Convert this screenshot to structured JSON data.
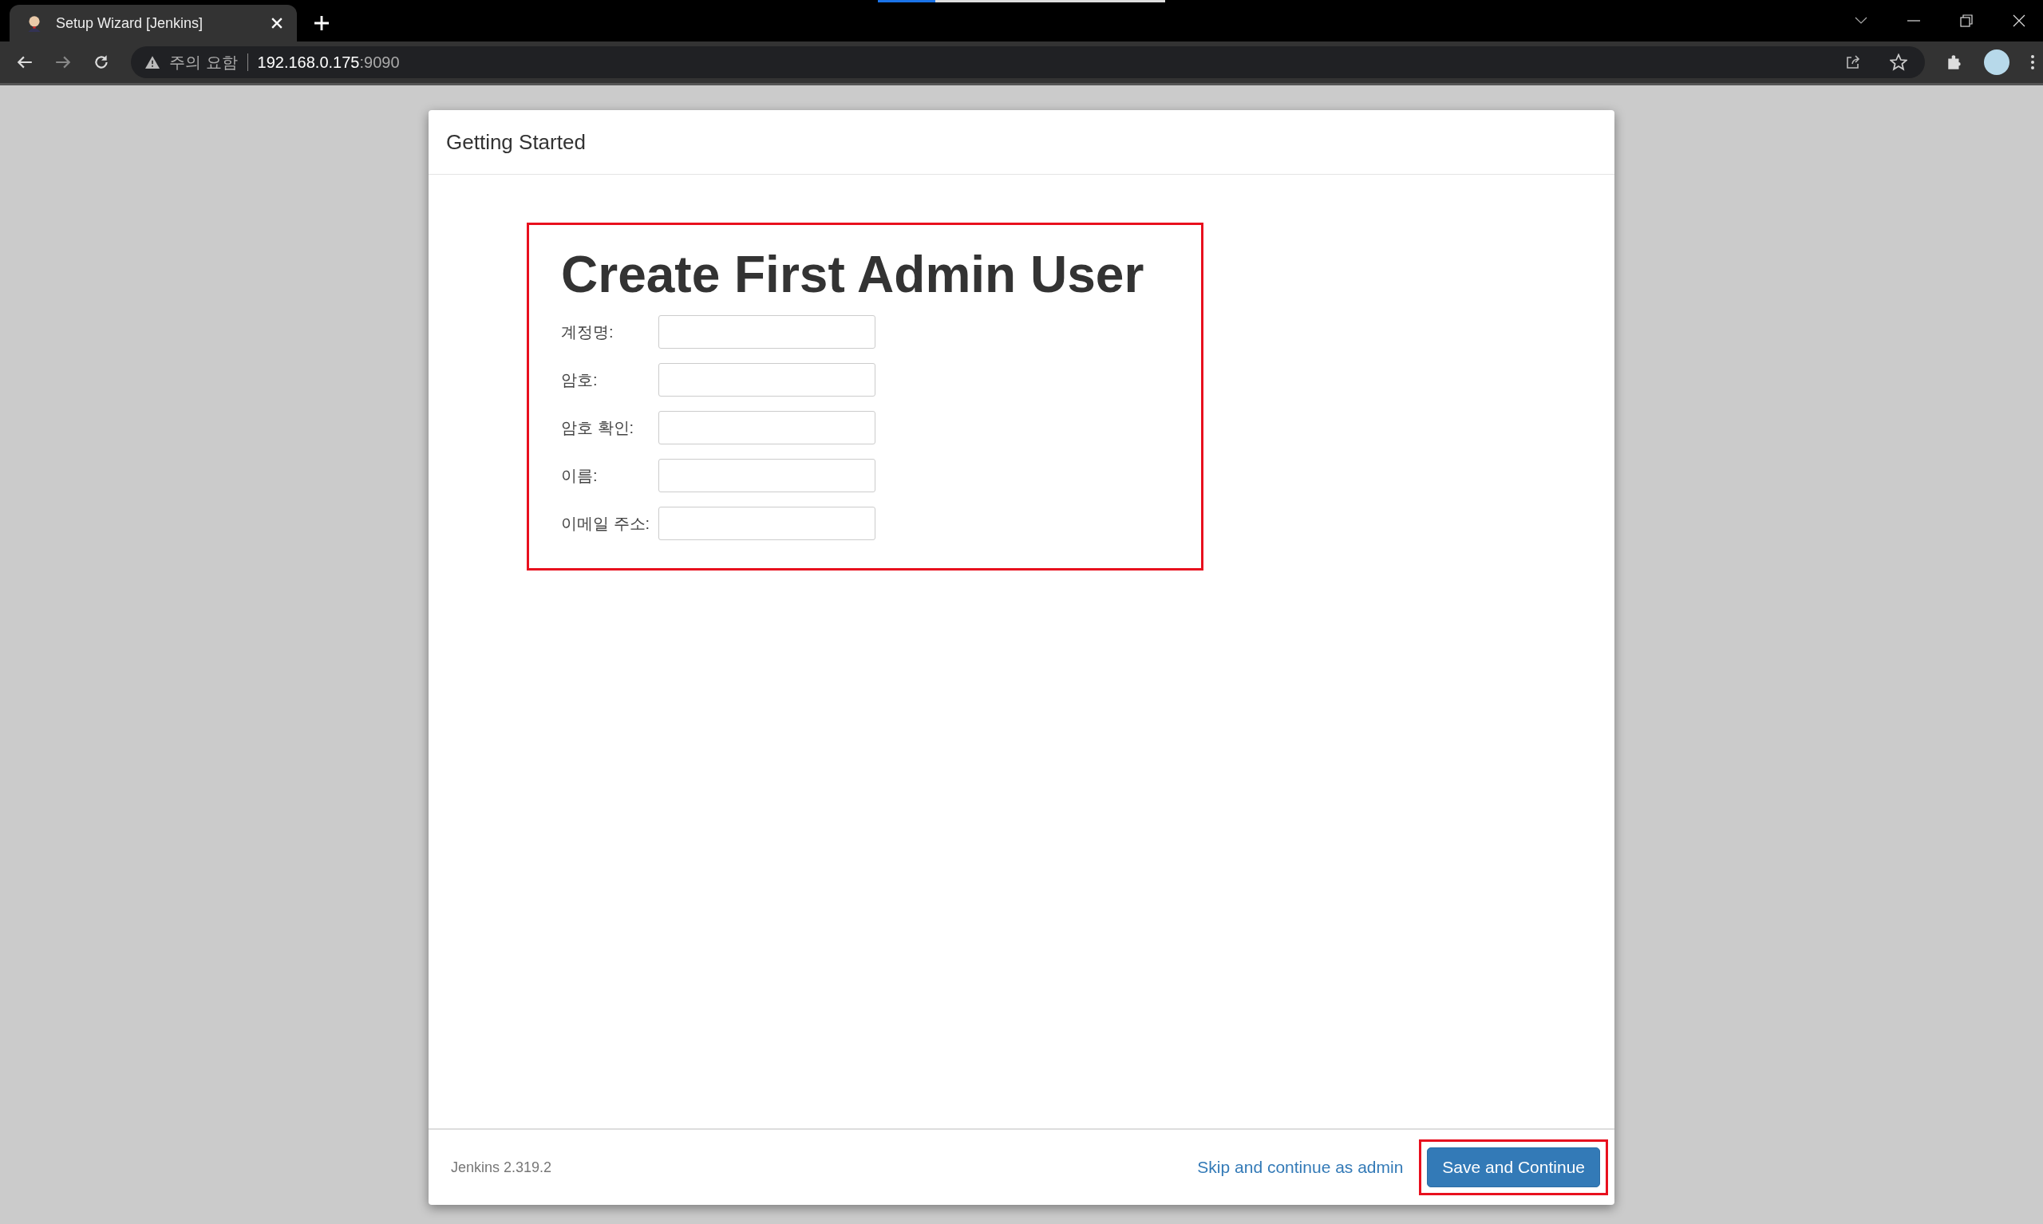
{
  "browser": {
    "tab": {
      "title": "Setup Wizard [Jenkins]",
      "selected": true
    },
    "address": {
      "warning": "주의 요함",
      "host": "192.168.0.175",
      "port": ":9090"
    }
  },
  "dialog": {
    "title": "Getting Started",
    "form": {
      "highlighted": true,
      "heading": "Create First Admin User",
      "fields": [
        {
          "label": "계정명:"
        },
        {
          "label": "암호:"
        },
        {
          "label": "암호 확인:"
        },
        {
          "label": "이름:"
        },
        {
          "label": "이메일 주소:"
        }
      ]
    },
    "footer": {
      "version": "Jenkins 2.319.2",
      "skip_link": "Skip and continue as admin",
      "save_button": {
        "label": "Save and Continue",
        "highlighted": true
      }
    }
  }
}
